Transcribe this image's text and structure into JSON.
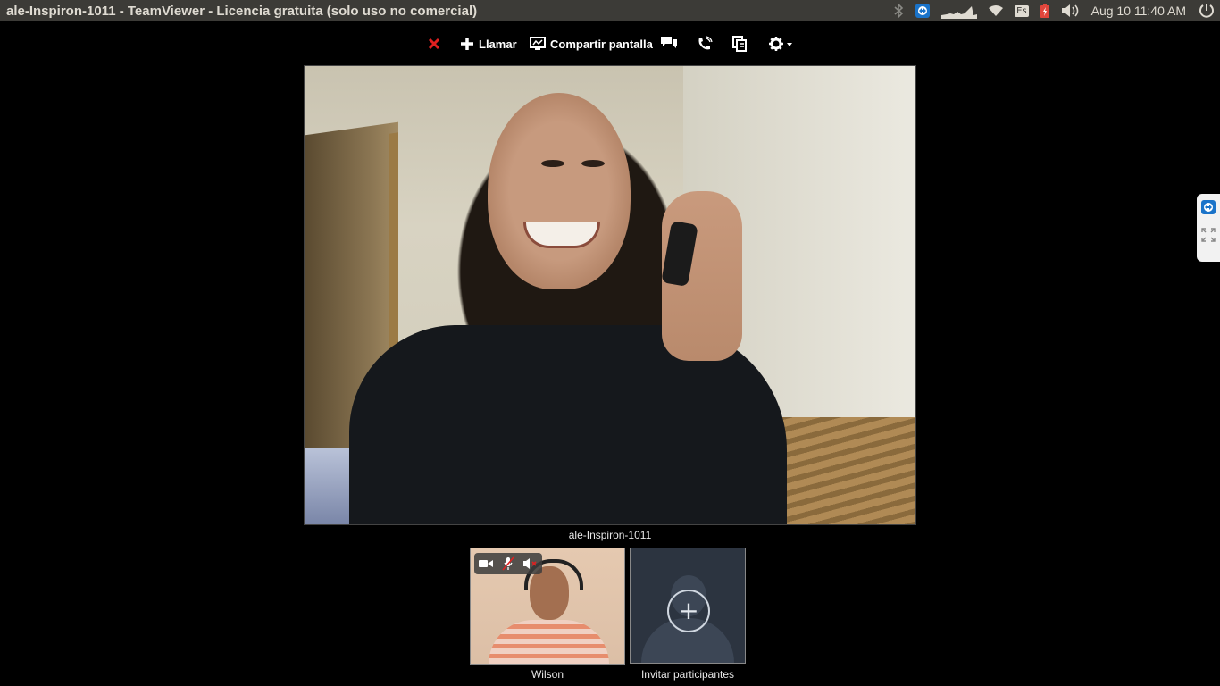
{
  "window": {
    "title": "ale-Inspiron-1011 - TeamViewer - Licencia gratuita (solo uso no comercial)"
  },
  "system_tray": {
    "language": "Es",
    "clock": "Aug 10 11:40 AM",
    "icons": [
      "bluetooth-icon",
      "teamviewer-tray-icon",
      "network-graph-icon",
      "wifi-icon",
      "keyboard-language-icon",
      "battery-icon",
      "volume-icon",
      "session-power-icon"
    ]
  },
  "toolbar": {
    "close_icon": "close-icon",
    "call_label": "Llamar",
    "share_label": "Compartir pantalla",
    "chat_icon": "chat-icon",
    "phone_icon": "phone-icon",
    "files_icon": "files-icon",
    "settings_icon": "gear-icon",
    "accent_close": "#e02020"
  },
  "main_video": {
    "participant_name": "ale-Inspiron-1011"
  },
  "participants": [
    {
      "name": "Wilson",
      "controls": [
        "video-camera-icon",
        "microphone-muted-icon",
        "speaker-muted-icon"
      ]
    },
    {
      "name": "Invitar participantes",
      "icon": "add-participant-icon"
    }
  ]
}
